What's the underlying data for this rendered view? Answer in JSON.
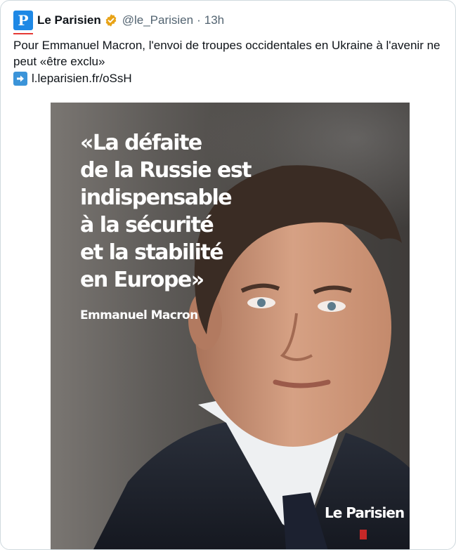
{
  "tweet": {
    "author_name": "Le Parisien",
    "avatar_letter": "P",
    "handle": "@le_Parisien",
    "separator": "·",
    "time": "13h",
    "text": "Pour Emmanuel Macron, l'envoi de troupes occidentales en Ukraine  à l'avenir ne peut «être exclu»",
    "link": "l.leparisien.fr/oSsH"
  },
  "media": {
    "quote": "«La défaite\nde la Russie est\nindispensable\nà la sécurité\net la stabilité\nen Europe»",
    "author": "Emmanuel Macron",
    "logo_text": "Le Parisien"
  },
  "colors": {
    "verified_badge": "#e8a317",
    "avatar_bg": "#1e88e5",
    "link_arrow_bg": "#3b94d9"
  },
  "icons": {
    "verified": "verified-badge-icon",
    "link": "right-arrow-icon"
  }
}
